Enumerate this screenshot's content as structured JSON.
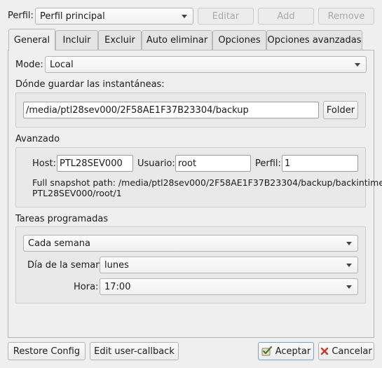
{
  "header": {
    "profile_label": "Perfil:",
    "profile_value": "Perfil principal",
    "edit_label": "Editar",
    "add_label": "Add",
    "remove_label": "Remove"
  },
  "tabs": [
    {
      "label": "General",
      "active": true
    },
    {
      "label": "Incluir",
      "active": false
    },
    {
      "label": "Excluir",
      "active": false
    },
    {
      "label": "Auto eliminar",
      "active": false
    },
    {
      "label": "Opciones",
      "active": false
    },
    {
      "label": "Opciones avanzadas",
      "active": false
    }
  ],
  "general": {
    "mode_label": "Mode:",
    "mode_value": "Local",
    "where_label": "Dónde guardar las instantáneas:",
    "path_value": "/media/ptl28sev000/2F58AE1F37B23304/backup",
    "folder_label": "Folder",
    "advanced_label": "Avanzado",
    "host_label": "Host:",
    "host_value": "PTL28SEV000",
    "user_label": "Usuario:",
    "user_value": "root",
    "profile_label": "Perfil:",
    "profile_value": "1",
    "snapshot_path_line1": "Full snapshot path: /media/ptl28sev000/2F58AE1F37B23304/backup/backintime/",
    "snapshot_path_line2": "PTL28SEV000/root/1",
    "schedule_label": "Tareas programadas",
    "schedule_value": "Cada semana",
    "weekday_label": "Día de la semana",
    "weekday_value": "lunes",
    "hour_label": "Hora:",
    "hour_value": "17:00"
  },
  "footer": {
    "restore_label": "Restore Config",
    "callback_label": "Edit user-callback",
    "accept_label": "Aceptar",
    "cancel_label": "Cancelar"
  },
  "colors": {
    "background": "#efefef",
    "cancel_icon": "#d0342c",
    "accept_icon": "#3f7f2f"
  }
}
